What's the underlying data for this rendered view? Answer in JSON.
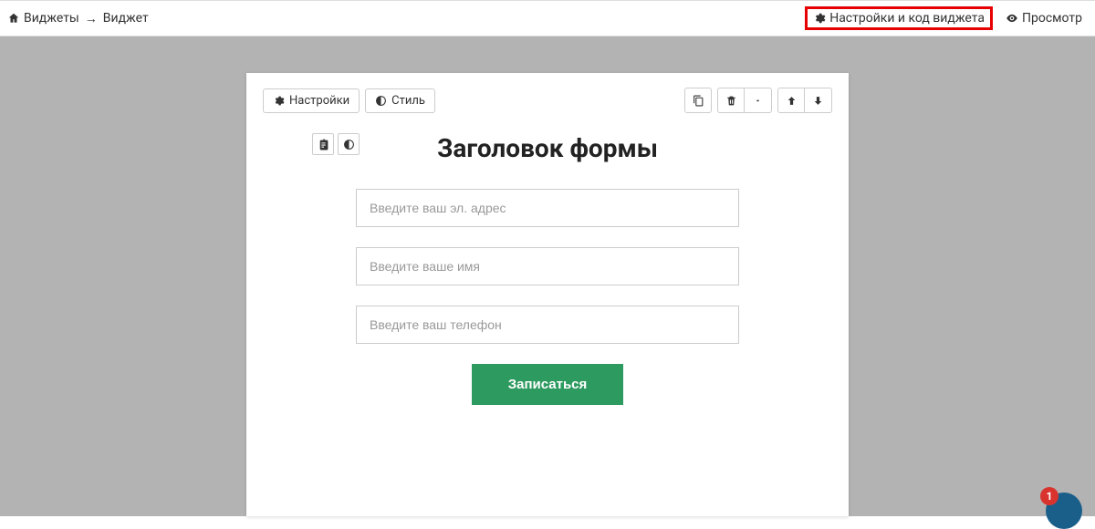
{
  "breadcrumb": {
    "root": "Виджеты",
    "separator": "→",
    "current": "Виджет"
  },
  "topbar": {
    "settings_code_label": "Настройки и код виджета",
    "preview_label": "Просмотр"
  },
  "card_toolbar": {
    "settings_label": "Настройки",
    "style_label": "Стиль"
  },
  "form": {
    "title": "Заголовок формы",
    "email_placeholder": "Введите ваш эл. адрес",
    "name_placeholder": "Введите ваше имя",
    "phone_placeholder": "Введите ваш телефон",
    "submit_label": "Записаться"
  },
  "notification": {
    "count": "1"
  }
}
